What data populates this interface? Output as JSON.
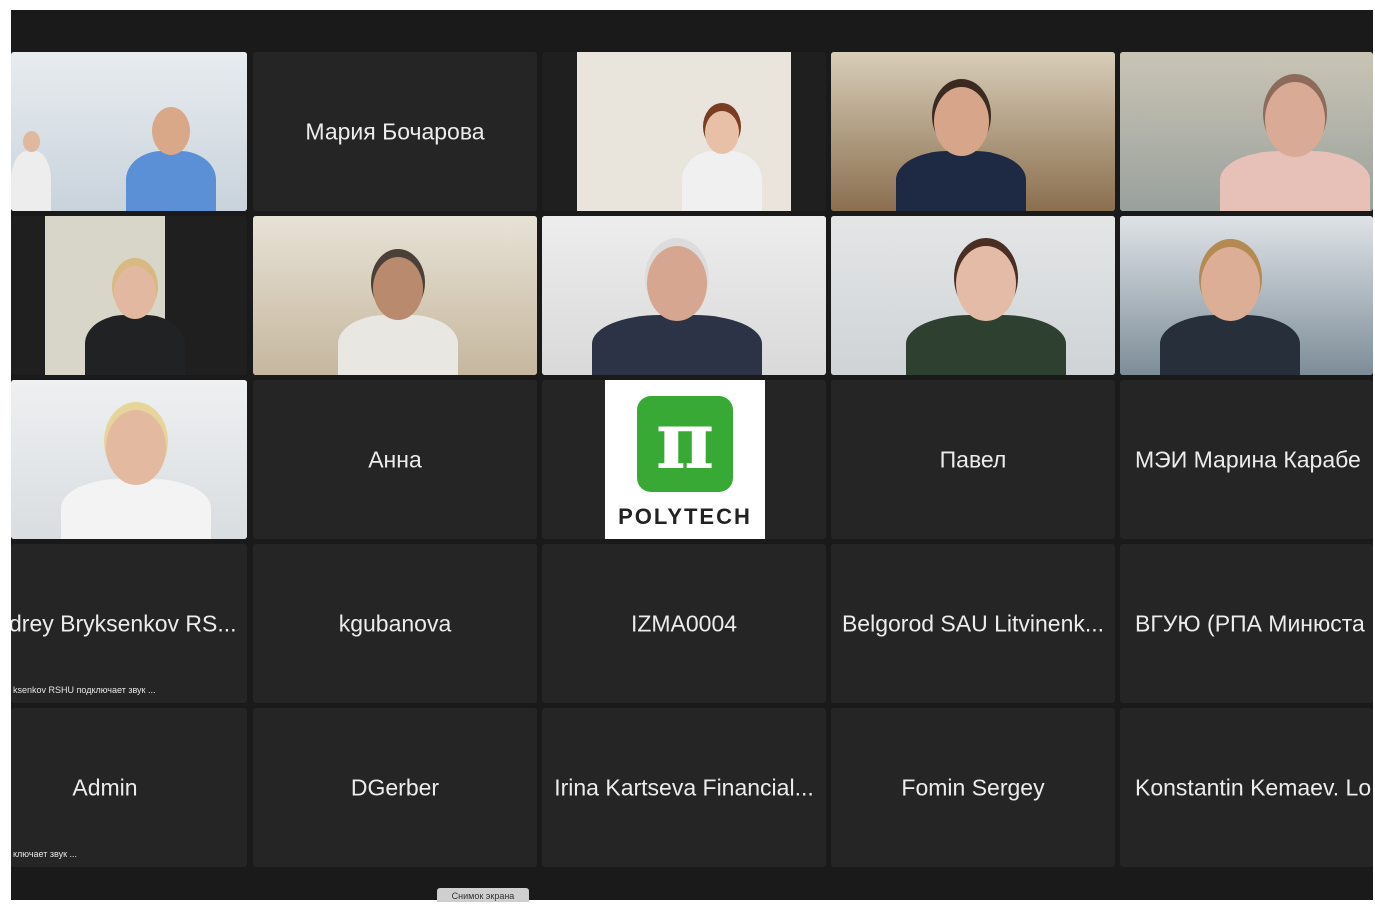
{
  "meeting": {
    "tiles": [
      {
        "type": "video",
        "id": "r1c1"
      },
      {
        "type": "name",
        "name": "Мария Бочарова"
      },
      {
        "type": "video",
        "id": "r1c3"
      },
      {
        "type": "video",
        "id": "r1c4",
        "active_speaker": true
      },
      {
        "type": "video",
        "id": "r1c5"
      },
      {
        "type": "video",
        "id": "r2c1"
      },
      {
        "type": "video",
        "id": "r2c2"
      },
      {
        "type": "video",
        "id": "r2c3"
      },
      {
        "type": "video",
        "id": "r2c4"
      },
      {
        "type": "video",
        "id": "r2c5"
      },
      {
        "type": "video",
        "id": "r3c1"
      },
      {
        "type": "name",
        "name": "Анна"
      },
      {
        "type": "logo",
        "logo_text": "POLYTECH",
        "logo_glyph": "π"
      },
      {
        "type": "name",
        "name": "Павел"
      },
      {
        "type": "name",
        "name": "МЭИ Марина Карабе"
      },
      {
        "type": "name",
        "name": "drey Bryksenkov RS...",
        "status": "ksenkov RSHU подключает звук ..."
      },
      {
        "type": "name",
        "name": "kgubanova"
      },
      {
        "type": "name",
        "name": "IZMA0004"
      },
      {
        "type": "name",
        "name": "Belgorod SAU Litvinenk..."
      },
      {
        "type": "name",
        "name": "ВГУЮ (РПА Минюста"
      },
      {
        "type": "name",
        "name": "Admin",
        "status": "ключает звук ..."
      },
      {
        "type": "name",
        "name": "DGerber"
      },
      {
        "type": "name",
        "name": "Irina Kartseva Financial..."
      },
      {
        "type": "name",
        "name": "Fomin Sergey"
      },
      {
        "type": "name",
        "name": "Konstantin Kemaev. Lo"
      }
    ],
    "screenshot_tooltip": "Снимок экрана",
    "colors": {
      "active_border": "#3ec43e",
      "tile_bg": "#252525",
      "logo_green": "#39a935"
    }
  }
}
